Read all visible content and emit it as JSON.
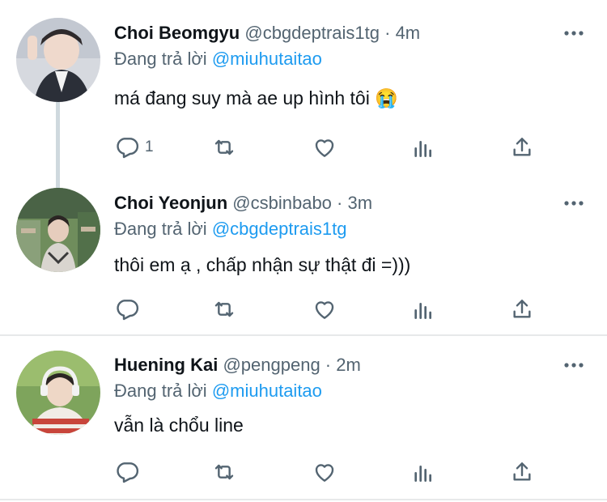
{
  "tweets": [
    {
      "name": "Choi Beomgyu",
      "meta": "@cbgdeptrais1tg · 4m",
      "reply_prefix": "Đang trả lời",
      "reply_handle": "@miuhutaitao",
      "text": "má đang suy mà ae up hình tôi 😭",
      "reply_count": "1",
      "avatar_colors": [
        "#c9cdd6",
        "#7d8593",
        "#2b2f38"
      ]
    },
    {
      "name": "Choi Yeonjun",
      "meta": "@csbinbabo · 3m",
      "reply_prefix": "Đang trả lời",
      "reply_handle": "@cbgdeptrais1tg",
      "text": "thôi em ạ , chấp nhận sự thật đi =)))",
      "reply_count": "",
      "avatar_colors": [
        "#6d8f5a",
        "#3e4a3a",
        "#c8c4bc"
      ]
    },
    {
      "name": "Huening Kai",
      "meta": "@pengpeng · 2m",
      "reply_prefix": "Đang trả lời",
      "reply_handle": "@miuhutaitao",
      "text": "vẫn là chổu line",
      "reply_count": "",
      "avatar_colors": [
        "#7aa05a",
        "#c8453b",
        "#f1ece6"
      ]
    }
  ],
  "icons": {
    "reply": "reply-icon",
    "retweet": "retweet-icon",
    "like": "like-icon",
    "views": "views-icon",
    "share": "share-icon",
    "more": "more-icon"
  },
  "colors": {
    "link": "#1d9bf0",
    "muted": "#536471",
    "text": "#0f1419",
    "divider": "#e7e9ea",
    "thread_line": "#cfd9de"
  }
}
